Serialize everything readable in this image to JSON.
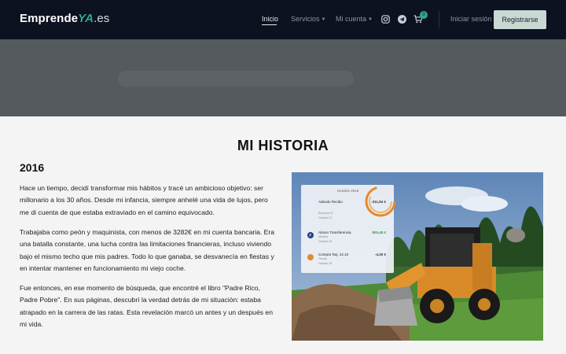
{
  "nav": {
    "logo": {
      "part1": "Emprende",
      "part2": "YA",
      "part3": ".es"
    },
    "items": [
      {
        "label": "Inicio",
        "active": true
      },
      {
        "label": "Servicios",
        "has_dropdown": true
      },
      {
        "label": "Mi cuenta",
        "has_dropdown": true
      }
    ],
    "social": [
      "instagram-icon",
      "telegram-icon"
    ],
    "cart": {
      "icon": "cart-icon",
      "count": "0"
    },
    "login_label": "Iniciar sesión",
    "register_label": "Registrarse"
  },
  "story": {
    "title": "MI HISTORIA",
    "year": "2016",
    "paragraphs": [
      "Hace un tiempo, decidí transformar mis hábitos y tracé un ambicioso objetivo: ser millonario a los 30 años. Desde mi infancia, siempre anhelé una vida de lujos, pero me di cuenta de que estaba extraviado en el camino equivocado.",
      "Trabajaba como peón y maquinista, con menos de 3282€ en mi cuenta bancaria. Era una batalla constante, una lucha contra las limitaciones financieras, incluso viviendo bajo el mismo techo que mis padres. Todo lo que ganaba, se desvanecía en fiestas y en intentar mantener en funcionamiento mi viejo coche.",
      "Fue entonces, en ese momento de búsqueda, que encontré el libro \"Padre Rico, Padre Pobre\". En sus páginas, descubrí la verdad detrás de mi situación: estaba atrapado en la carrera de las ratas. Esta revelación marcó un antes y un después en mi vida."
    ]
  },
  "photo": {
    "card": {
      "header": "Octubre 2016",
      "rows": [
        {
          "title": "Adeudo Recibo",
          "sub": "Empresa SI",
          "date": "Octubre 21",
          "amount": "-311,84 €"
        },
        {
          "title": "Abono Transferencia",
          "sub": "Nómina",
          "date": "Octubre 20",
          "amount": "800,45 €"
        },
        {
          "title": "Compra Tarj. 22.10",
          "sub": "Tienda",
          "date": "Octubre 18",
          "amount": "-4,30 €"
        }
      ]
    }
  },
  "colors": {
    "nav_bg": "#0c1220",
    "accent": "#2fa88c",
    "register_bg": "#c8d8d3",
    "page_bg": "#f4f4f4"
  }
}
